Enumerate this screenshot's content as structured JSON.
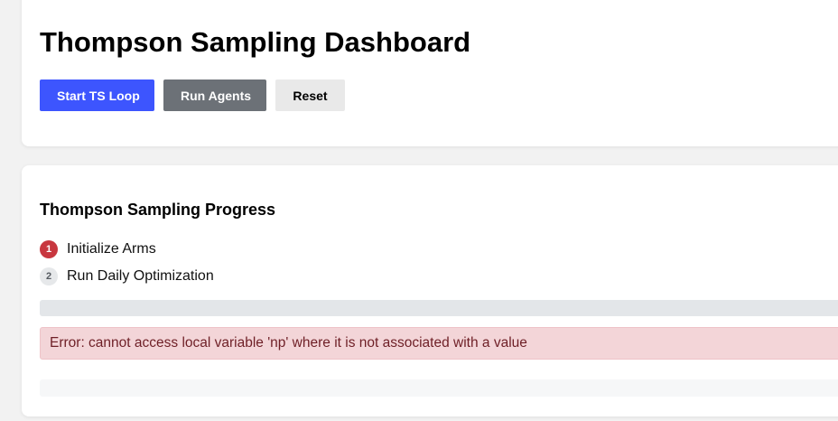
{
  "header": {
    "title": "Thompson Sampling Dashboard",
    "buttons": {
      "start_label": "Start TS Loop",
      "run_agents_label": "Run Agents",
      "reset_label": "Reset"
    }
  },
  "progress_section": {
    "title": "Thompson Sampling Progress",
    "steps": [
      {
        "number": "1",
        "label": "Initialize Arms",
        "state": "active"
      },
      {
        "number": "2",
        "label": "Run Daily Optimization",
        "state": "pending"
      }
    ],
    "progress_value": 0,
    "error_message": "Error: cannot access local variable 'np' where it is not associated with a value",
    "log_text": ""
  },
  "colors": {
    "primary": "#3d55fe",
    "secondary": "#6c7177",
    "light": "#e9e9e9",
    "step_active": "#c8373f",
    "error_bg": "#f3d5d8",
    "error_text": "#6e1f26"
  }
}
